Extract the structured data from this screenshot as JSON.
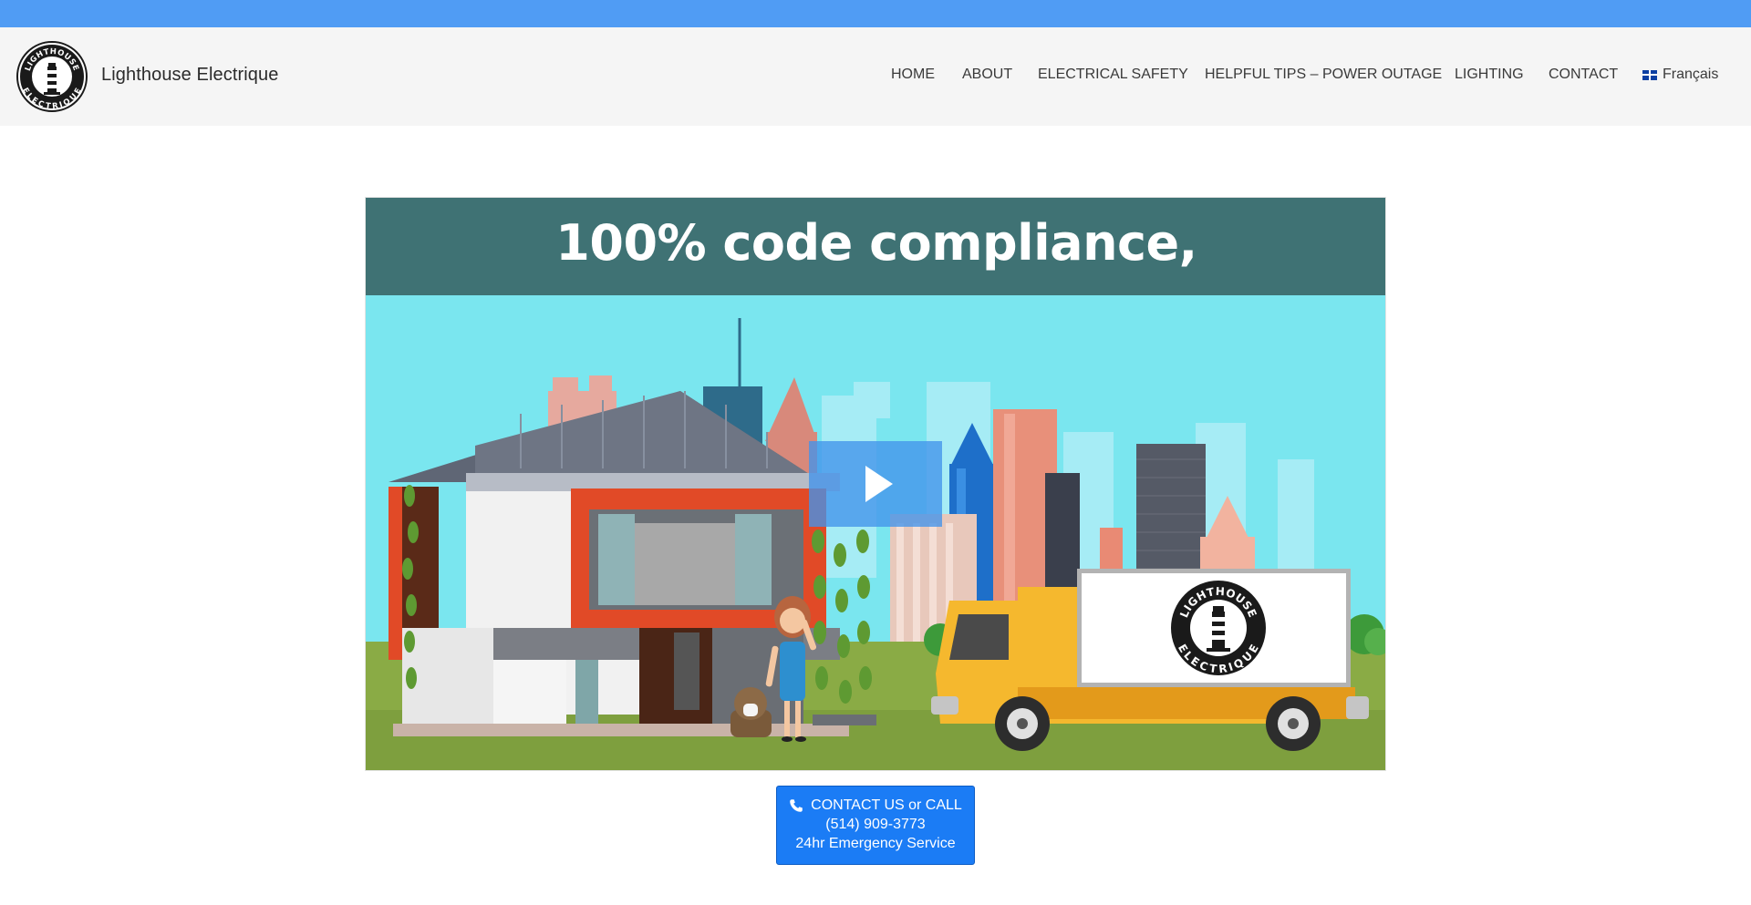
{
  "site": {
    "title": "Lighthouse Electrique",
    "logo": {
      "text_top": "LIGHTHOUSE",
      "text_bottom": "ELECTRIQUE"
    }
  },
  "nav": {
    "items": [
      {
        "label": "HOME"
      },
      {
        "label": "ABOUT"
      },
      {
        "label": "ELECTRICAL SAFETY"
      },
      {
        "label": "HELPFUL TIPS – POWER OUTAGE"
      },
      {
        "label": "LIGHTING"
      },
      {
        "label": "CONTACT"
      }
    ],
    "language": {
      "label": "Français",
      "icon": "french-flag-icon"
    }
  },
  "video": {
    "banner_text": "100% code compliance,",
    "play_icon": "play-icon",
    "truck_logo": {
      "text_top": "LIGHTHOUSE",
      "text_bottom": "ELECTRIQUE"
    }
  },
  "cta": {
    "icon": "phone-icon",
    "line1": "CONTACT US or CALL",
    "line2": "(514) 909-3773",
    "line3": "24hr Emergency Service"
  },
  "colors": {
    "top_strip": "#509cf4",
    "header_bg": "#f5f5f5",
    "banner_bg": "#3f7274",
    "sky": "#7ae6ef",
    "cta_bg": "#1b7cf5"
  }
}
